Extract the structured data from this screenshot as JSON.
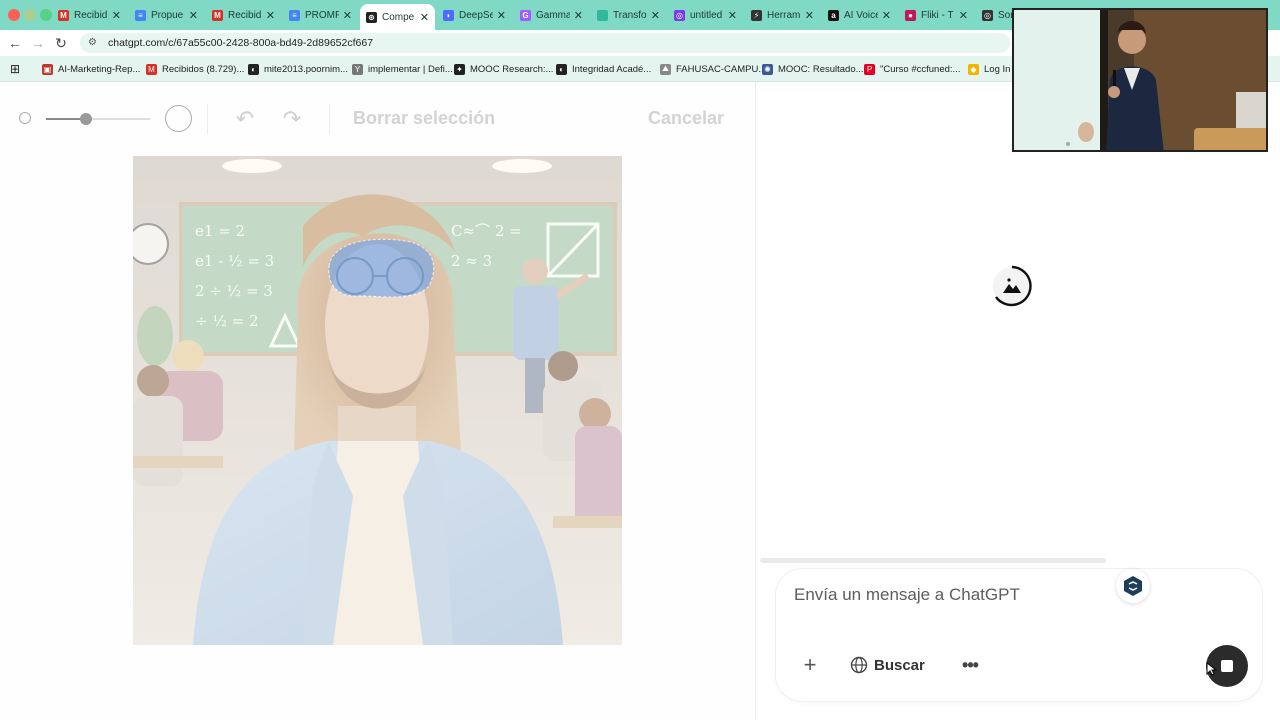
{
  "browser": {
    "tabs": [
      {
        "title": "Recibid",
        "color": "#d93025",
        "glyph": "M",
        "active": false
      },
      {
        "title": "Propue",
        "color": "#4285f4",
        "glyph": "≡",
        "active": false
      },
      {
        "title": "Recibid",
        "color": "#d93025",
        "glyph": "M",
        "active": false
      },
      {
        "title": "PROMP",
        "color": "#4285f4",
        "glyph": "≡",
        "active": false
      },
      {
        "title": "Compe",
        "color": "#222222",
        "glyph": "⊛",
        "active": true
      },
      {
        "title": "DeepSe",
        "color": "#4d6bfe",
        "glyph": "◗",
        "active": false
      },
      {
        "title": "Gamma",
        "color": "#a259ff",
        "glyph": "G",
        "active": false
      },
      {
        "title": "Transfo",
        "color": "#2fb89a",
        "glyph": "",
        "active": false
      },
      {
        "title": "untitled",
        "color": "#7c3aed",
        "glyph": "◎",
        "active": false
      },
      {
        "title": "Herram",
        "color": "#333333",
        "glyph": "⚡",
        "active": false
      },
      {
        "title": "AI Voice",
        "color": "#111111",
        "glyph": "a",
        "active": false
      },
      {
        "title": "Fliki - T",
        "color": "#c2185b",
        "glyph": "●",
        "active": false
      },
      {
        "title": "Sora",
        "color": "#333333",
        "glyph": "◎",
        "active": false
      }
    ],
    "close_glyph": "✕",
    "address": "chatgpt.com/c/67a55c00-2428-800a-bd49-2d89652cf667",
    "nav": {
      "back": "←",
      "forward": "→",
      "reload": "↻",
      "apps": "⊞"
    },
    "bookmarks": [
      {
        "label": "AI-Marketing-Rep...",
        "color": "#c0392b",
        "glyph": "▣"
      },
      {
        "label": "Recibidos (8.729)...",
        "color": "#d93025",
        "glyph": "M"
      },
      {
        "label": "mite2013.poornim...",
        "color": "#222222",
        "glyph": "◐"
      },
      {
        "label": "implementar | Defi...",
        "color": "#777777",
        "glyph": "Y"
      },
      {
        "label": "MOOC Research:...",
        "color": "#222222",
        "glyph": "✦"
      },
      {
        "label": "Integridad Acadé...",
        "color": "#222222",
        "glyph": "◐"
      },
      {
        "label": "FAHUSAC-CAMPU...",
        "color": "#888888",
        "glyph": "⛰"
      },
      {
        "label": "MOOC: Resultado...",
        "color": "#3b5998",
        "glyph": "✺"
      },
      {
        "label": "\"Curso #ccfuned:...",
        "color": "#e60023",
        "glyph": "P"
      },
      {
        "label": "Log In",
        "color": "#f4b400",
        "glyph": "◆"
      }
    ]
  },
  "editor": {
    "brush_size_fraction": 0.38,
    "undo_glyph": "↶",
    "redo_glyph": "↷",
    "clear_label": "Borrar selección",
    "cancel_label": "Cancelar"
  },
  "canvas": {
    "board_formulas": [
      "e1 = 2",
      "e1 - ½ = 3",
      "2 ÷ ½ = 3",
      "÷ ½ = 2",
      "C≈⌒ 2 =",
      "2 ≈ 3"
    ]
  },
  "chat": {
    "placeholder": "Envía un mensaje a ChatGPT",
    "plus_glyph": "+",
    "search_label": "Buscar",
    "more_glyph": "•••"
  },
  "colors": {
    "tabstrip": "#7fd9c4",
    "bookmarks_bg": "#e4f4ef",
    "mask": "#6aa3f0"
  }
}
